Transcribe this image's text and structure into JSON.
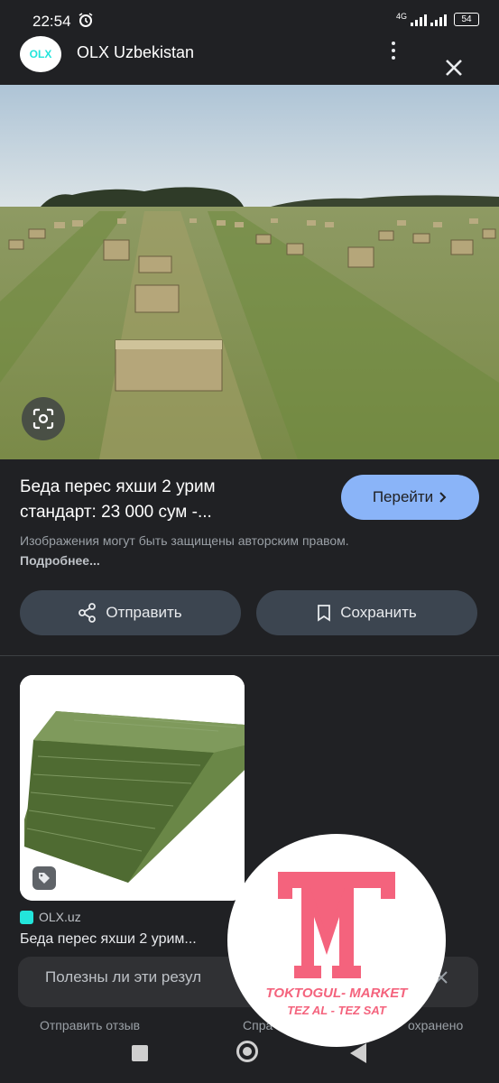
{
  "status": {
    "time": "22:54",
    "network": "4G",
    "battery": "54"
  },
  "header": {
    "site_name": "OLX Uzbekistan",
    "logo_text": "OLX"
  },
  "result": {
    "title_line1": "Беда перес яхши 2 урим",
    "title_line2": "стандарт: 23 000 сум -...",
    "go_label": "Перейти",
    "copyright_note": "Изображения могут быть защищены авторским правом.",
    "more_label": "Подробнее..."
  },
  "actions": {
    "share_label": "Отправить",
    "save_label": "Сохранить"
  },
  "related": {
    "source": "OLX.uz",
    "title": "Беда перес яхши 2 урим..."
  },
  "feedback": {
    "question": "Полезны ли эти резул"
  },
  "footer": {
    "send_feedback": "Отправить отзыв",
    "help": "Спра",
    "saved": "охранено"
  },
  "watermark": {
    "brand": "TOKTOGUL- MARKET",
    "slogan": "TEZ AL - TEZ SAT"
  },
  "colors": {
    "accent": "#8ab4f8",
    "olx_teal": "#23e5db",
    "watermark_pink": "#f4637d",
    "background": "#202124"
  }
}
